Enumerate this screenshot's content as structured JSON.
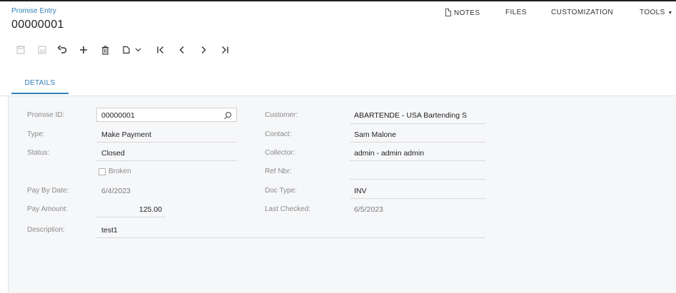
{
  "header": {
    "breadcrumb": "Promise Entry",
    "title": "00000001"
  },
  "top_actions": {
    "notes": "NOTES",
    "files": "FILES",
    "customization": "CUSTOMIZATION",
    "tools": "TOOLS"
  },
  "toolbar": {
    "icons": [
      "save-icon",
      "save-close-icon",
      "undo-icon",
      "add-icon",
      "delete-icon",
      "copy-paste-icon",
      "first-record-icon",
      "previous-record-icon",
      "next-record-icon",
      "last-record-icon"
    ]
  },
  "tabs": [
    {
      "label": "DETAILS",
      "active": true
    }
  ],
  "form": {
    "promise_id": {
      "label": "Promise ID:",
      "value": "00000001"
    },
    "type": {
      "label": "Type:",
      "value": "Make Payment"
    },
    "status": {
      "label": "Status:",
      "value": "Closed"
    },
    "broken": {
      "label": "Broken",
      "checked": false
    },
    "pay_by_date": {
      "label": "Pay By Date:",
      "value": "6/4/2023"
    },
    "pay_amount": {
      "label": "Pay Amount:",
      "value": "125.00"
    },
    "description": {
      "label": "Description:",
      "value": "test1"
    },
    "customer": {
      "label": "Customer:",
      "value": "ABARTENDE - USA Bartending S"
    },
    "contact": {
      "label": "Contact:",
      "value": "Sam Malone"
    },
    "collector": {
      "label": "Collector:",
      "value": "admin - admin admin"
    },
    "ref_nbr": {
      "label": "Ref Nbr:",
      "value": ""
    },
    "doc_type": {
      "label": "Doc Type:",
      "value": "INV"
    },
    "last_checked": {
      "label": "Last Checked:",
      "value": "6/5/2023"
    }
  },
  "colors": {
    "accent": "#2f7fb8",
    "panel": "#f6f7f9",
    "label": "#8a8a8a"
  }
}
